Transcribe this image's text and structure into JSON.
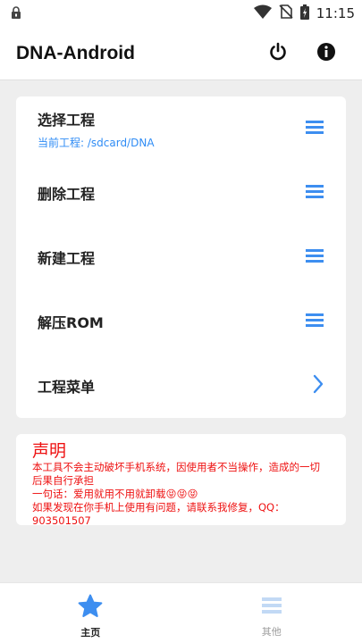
{
  "status_bar": {
    "time": "11:15",
    "icons": [
      "lock-icon",
      "wifi-icon",
      "no-sim-icon",
      "battery-icon"
    ]
  },
  "app_bar": {
    "title": "DNA-Android",
    "actions": [
      "power-icon",
      "info-icon"
    ]
  },
  "menu": {
    "items": [
      {
        "label": "选择工程",
        "sub": "当前工程: /sdcard/DNA",
        "icon": "hamburger-icon"
      },
      {
        "label": "删除工程",
        "icon": "hamburger-icon"
      },
      {
        "label": "新建工程",
        "icon": "hamburger-icon"
      },
      {
        "label": "解压ROM",
        "icon": "hamburger-icon"
      },
      {
        "label": "工程菜单",
        "icon": "chevron-right-icon"
      }
    ]
  },
  "notice": {
    "title": "声明",
    "lines": [
      "本工具不会主动破坏手机系统，因使用者不当操作，造成的一切后果自行承担",
      "一句话：爱用就用不用就卸载",
      "如果发现在你手机上使用有问题，请联系我修复，QQ：903501507"
    ],
    "emoji": "😝😝😝"
  },
  "bottom_nav": {
    "tabs": [
      {
        "label": "主页",
        "icon": "star-icon",
        "active": true
      },
      {
        "label": "其他",
        "icon": "hamburger-icon",
        "active": false
      }
    ]
  },
  "colors": {
    "accent": "#2f8cf5",
    "icon_blue": "#3d8ef0",
    "notice_red": "#ee1111",
    "background": "#eeeeee"
  }
}
